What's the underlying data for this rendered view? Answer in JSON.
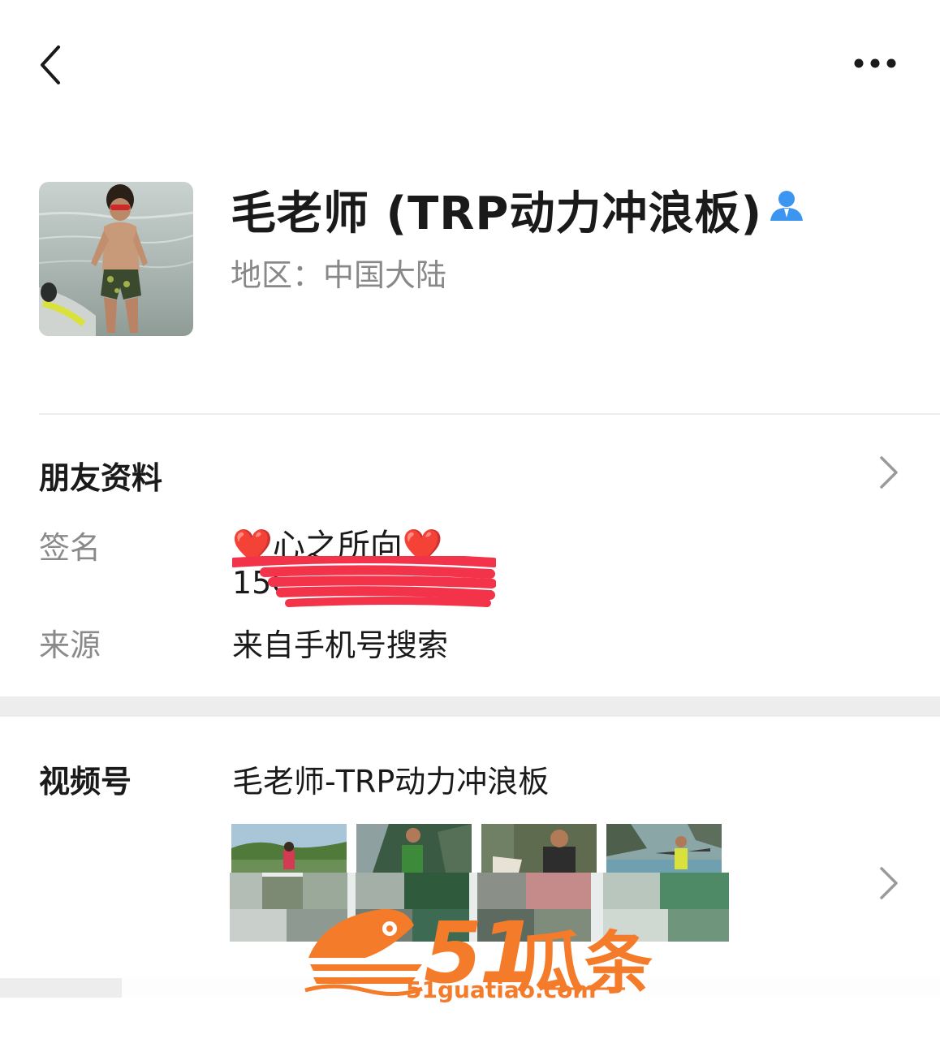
{
  "header": {
    "back_icon": "chevron-left-icon",
    "more_icon": "ellipsis-icon"
  },
  "profile": {
    "name": "毛老师 (TRP动力冲浪板)",
    "contact_icon": "person-icon",
    "region_label": "地区：中国大陆"
  },
  "friend_info": {
    "title": "朋友资料",
    "signature_label": "签名",
    "signature_heart_left": "❤️",
    "signature_text": "心之所向",
    "signature_heart_right": "❤️",
    "phone_partial": "15C",
    "source_label": "来源",
    "source_value": "来自手机号搜索"
  },
  "channels": {
    "title": "视频号",
    "channel_name": "毛老师-TRP动力冲浪板"
  },
  "watermark": {
    "number": "51",
    "text": "瓜条",
    "url": "51guatiao.com"
  },
  "colors": {
    "accent_blue": "#3d95f2",
    "label_gray": "#8a8a8a",
    "band_gray": "#ededed",
    "watermark_orange": "#f47b2a",
    "redaction_red": "#f2334a"
  }
}
